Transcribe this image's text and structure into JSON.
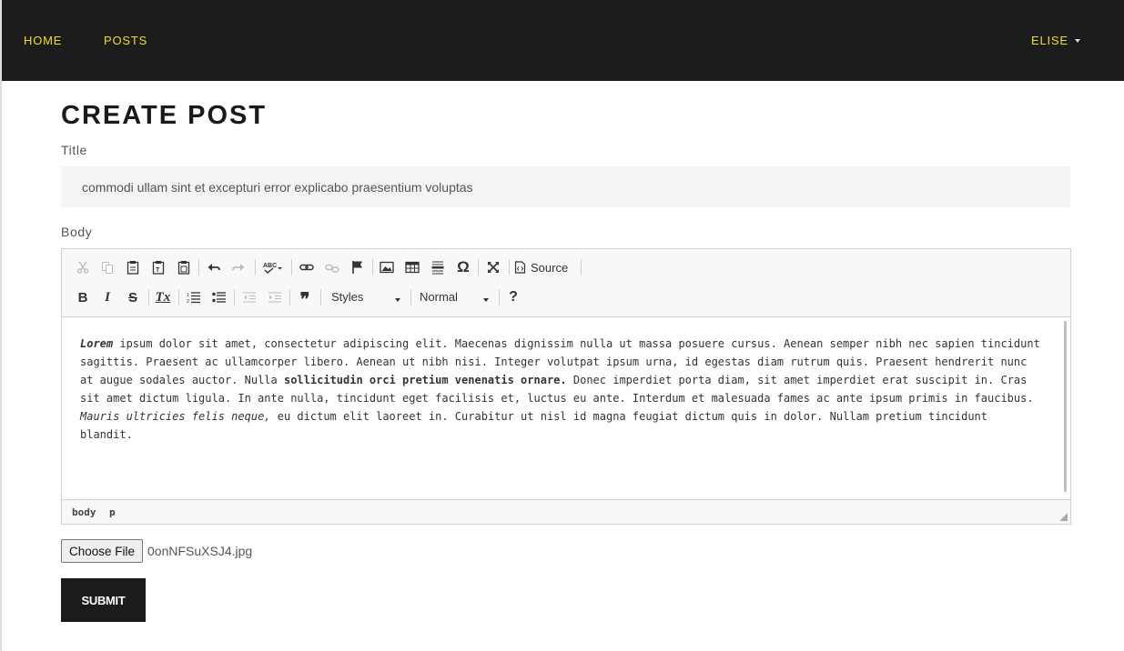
{
  "navbar": {
    "home": "HOME",
    "posts": "POSTS",
    "user": "ELISE"
  },
  "page": {
    "title": "CREATE POST",
    "title_label": "Title",
    "body_label": "Body"
  },
  "form": {
    "title_value": "commodi ullam sint et excepturi error explicabo praesentium voluptas",
    "file_button": "Choose File",
    "file_name": "0onNFSuXSJ4.jpg",
    "submit": "SUBMIT"
  },
  "editor": {
    "toolbar": {
      "source_label": "Source",
      "styles_label": "Styles",
      "format_label": "Normal",
      "help_label": "?",
      "blockquote_glyph": "❞",
      "omega_glyph": "Ω",
      "spellcheck_label": "ABC",
      "bold_label": "B",
      "italic_label": "I",
      "strike_label": "S",
      "removeformat_label": "Tx"
    },
    "content": {
      "lead_italic_bold": "Lorem",
      "part1": " ipsum dolor sit amet, consectetur adipiscing elit. Maecenas dignissim nulla ut massa posuere cursus. Aenean semper nibh nec sapien tincidunt sagittis. Praesent ac ullamcorper libero. Aenean ut nibh nisi. Integer volutpat ipsum urna, id egestas diam rutrum quis. Praesent hendrerit nunc at augue sodales auctor. Nulla ",
      "bold_phrase": "sollicitudin orci pretium venenatis ornare.",
      "part2": " Donec imperdiet porta diam, sit amet imperdiet erat suscipit in. Cras sit amet dictum ligula. In ante nulla, tincidunt eget facilisis et, luctus eu ante. Interdum et malesuada fames ac ante ipsum primis in faucibus. ",
      "italic_phrase": "Mauris ultricies felis neque,",
      "part3": " eu dictum elit laoreet in. Curabitur ut nisl id magna feugiat dictum quis in dolor. Nullam pretium tincidunt blandit."
    },
    "path": [
      "body",
      "p"
    ]
  }
}
